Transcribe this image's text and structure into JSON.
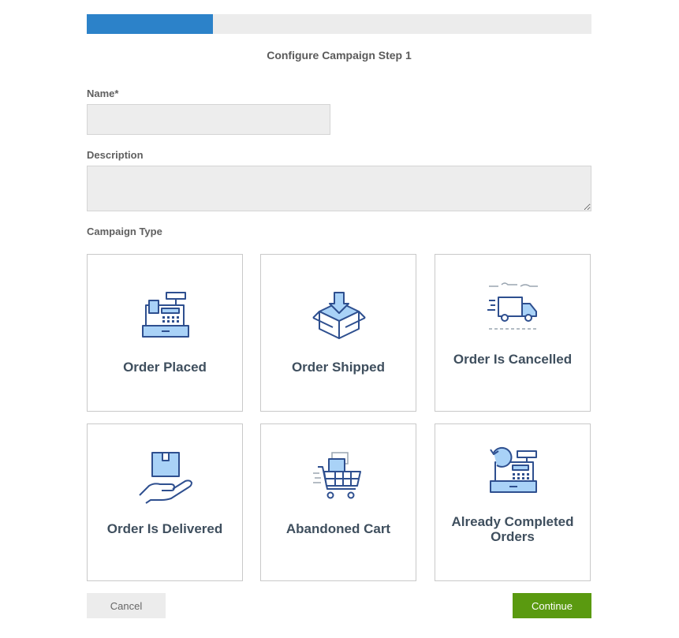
{
  "progress": {
    "fraction": 0.25
  },
  "title": "Configure Campaign Step 1",
  "form": {
    "name_label": "Name*",
    "name_value": "",
    "description_label": "Description",
    "description_value": "",
    "campaign_type_label": "Campaign Type"
  },
  "campaign_types": [
    {
      "label": "Order Placed",
      "icon": "cash-register-icon"
    },
    {
      "label": "Order Shipped",
      "icon": "box-download-icon"
    },
    {
      "label": "Order Is Cancelled",
      "icon": "delivery-truck-icon"
    },
    {
      "label": "Order Is Delivered",
      "icon": "package-in-hand-icon"
    },
    {
      "label": "Abandoned Cart",
      "icon": "shopping-cart-icon"
    },
    {
      "label": "Already Completed Orders",
      "icon": "register-refresh-icon"
    }
  ],
  "buttons": {
    "cancel": "Cancel",
    "continue": "Continue"
  },
  "colors": {
    "progress": "#2c82c9",
    "continue": "#5a9a10",
    "icon_stroke": "#2e4f8f",
    "icon_fill": "#a9d2f7"
  }
}
